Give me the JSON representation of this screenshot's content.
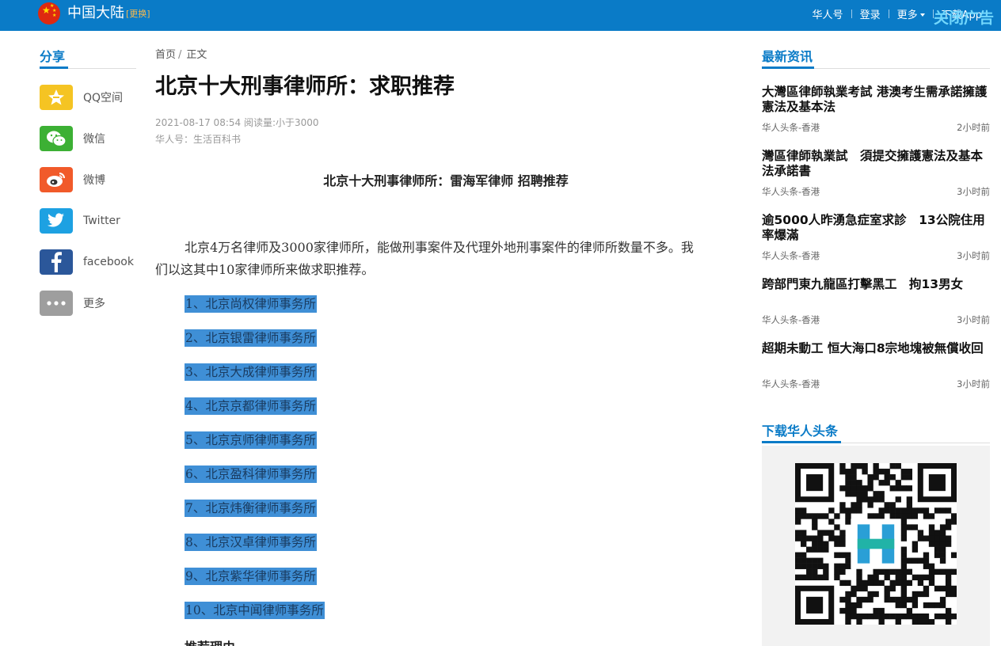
{
  "header": {
    "region": "中国大陆",
    "change_label": "[更换]",
    "nav": [
      "华人号",
      "登录",
      "更多",
      "下载App"
    ],
    "ad_tag": "关闭广告",
    "brand_color": "#0a7bc7"
  },
  "share": {
    "heading": "分享",
    "items": [
      {
        "label": "QQ空间",
        "icon": "qzone-star-icon",
        "color": "#f5c423"
      },
      {
        "label": "微信",
        "icon": "wechat-icon",
        "color": "#3cb034"
      },
      {
        "label": "微博",
        "icon": "weibo-icon",
        "color": "#f15a2a"
      },
      {
        "label": "Twitter",
        "icon": "twitter-icon",
        "color": "#1da1e2"
      },
      {
        "label": "facebook",
        "icon": "facebook-icon",
        "color": "#2b579a"
      },
      {
        "label": "更多",
        "icon": "more-dots-icon",
        "color": "#9e9e9e"
      }
    ]
  },
  "breadcrumb": {
    "home": "首页",
    "current": "正文"
  },
  "article": {
    "title": "北京十大刑事律师所：求职推荐",
    "meta_line1": "2021-08-17 08:54 阅读量:小于3000",
    "meta_line2": "华人号：生活百科书",
    "subtitle": "北京十大刑事律师所：雷海军律师  招聘推荐",
    "intro": "北京4万名律师及3000家律师所，能做刑事案件及代理外地刑事案件的律师所数量不多。我们以这其中10家律师所来做求职推荐。",
    "list": [
      "1、北京尚权律师事务所",
      "2、北京银雷律师事务所",
      "3、北京大成律师事务所",
      "4、北京京都律师事务所",
      "5、北京京师律师事务所",
      "6、北京盈科律师事务所",
      "7、北京炜衡律师事务所",
      "8、北京汉卓律师事务所",
      "9、北京紫华律师事务所",
      "10、北京中闻律师事务所"
    ],
    "reason_heading": "推荐理由"
  },
  "news": {
    "heading": "最新资讯",
    "items": [
      {
        "title": "大灣區律師執業考試 港澳考生需承諾擁護憲法及基本法",
        "source": "华人头条-香港",
        "time": "2小时前"
      },
      {
        "title": "灣區律師執業試　須提交擁護憲法及基本法承諾書",
        "source": "华人头条-香港",
        "time": "3小时前"
      },
      {
        "title": "逾5000人昨湧急症室求診　13公院住用率爆滿",
        "source": "华人头条-香港",
        "time": "3小时前"
      },
      {
        "title": "跨部門東九龍區打擊黑工　拘13男女",
        "source": "华人头条-香港",
        "time": "3小时前"
      },
      {
        "title": "超期未動工 恒大海口8宗地塊被無償收回",
        "source": "华人头条-香港",
        "time": "3小时前"
      }
    ]
  },
  "download": {
    "heading": "下载华人头条"
  }
}
